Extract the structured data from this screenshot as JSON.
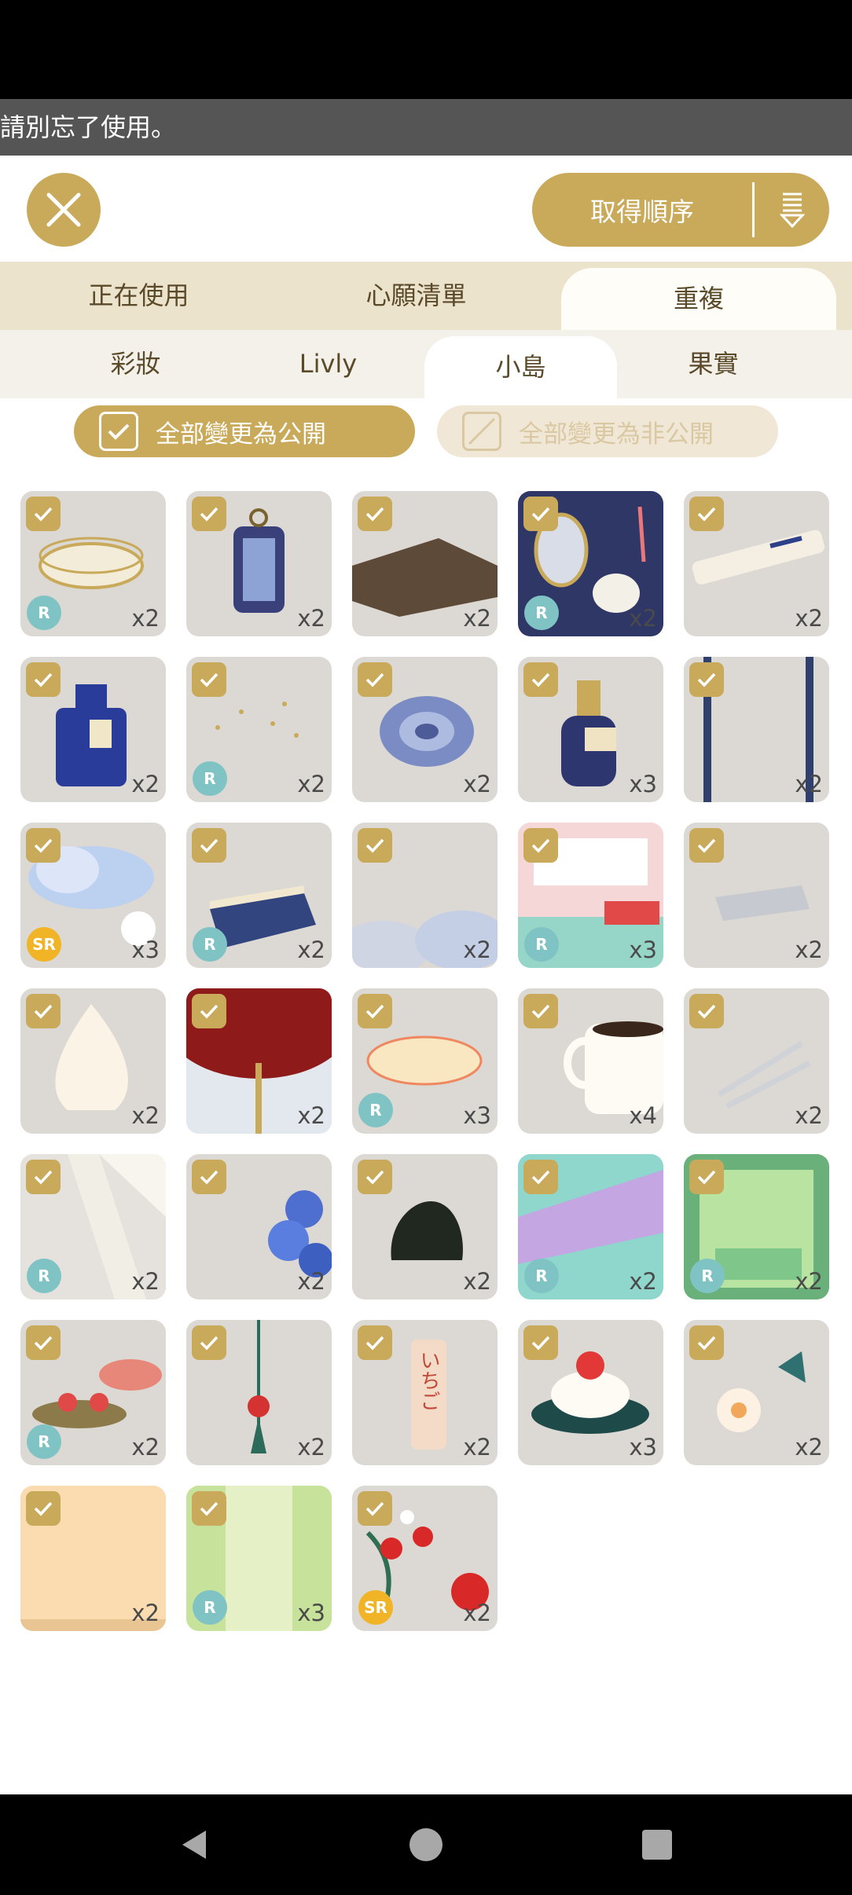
{
  "notice": "請別忘了使用。",
  "sort": {
    "label": "取得順序"
  },
  "tabs": [
    "正在使用",
    "心願清單",
    "重複"
  ],
  "subtabs": [
    "彩妝",
    "Livly",
    "小島",
    "果實"
  ],
  "buttons": {
    "public_all": "全部變更為公開",
    "private_all": "全部變更為非公開"
  },
  "colors": {
    "accent": "#c9a95a",
    "tile_bg": "#dcd8d3",
    "rarity_r": "#7fc3c5",
    "rarity_sr": "#f0b426"
  },
  "items": [
    {
      "icon": "glass-dish-icon",
      "rarity": "R",
      "count": "x2"
    },
    {
      "icon": "lantern-icon",
      "rarity": "",
      "count": "x2"
    },
    {
      "icon": "wooden-floor-icon",
      "rarity": "",
      "count": "x2"
    },
    {
      "icon": "mirror-vanity-icon",
      "rarity": "R",
      "count": "x2"
    },
    {
      "icon": "pen-icon",
      "rarity": "",
      "count": "x2"
    },
    {
      "icon": "perfume-bottle-icon",
      "rarity": "",
      "count": "x2"
    },
    {
      "icon": "sparkles-icon",
      "rarity": "R",
      "count": "x2"
    },
    {
      "icon": "shell-icon",
      "rarity": "",
      "count": "x2"
    },
    {
      "icon": "bottle-icon",
      "rarity": "",
      "count": "x3"
    },
    {
      "icon": "pillars-icon",
      "rarity": "",
      "count": "x2"
    },
    {
      "icon": "cloud-icon",
      "rarity": "SR",
      "count": "x3"
    },
    {
      "icon": "book-icon",
      "rarity": "R",
      "count": "x2"
    },
    {
      "icon": "cloud-floor-icon",
      "rarity": "",
      "count": "x2"
    },
    {
      "icon": "shop-counter-icon",
      "rarity": "R",
      "count": "x3"
    },
    {
      "icon": "newspaper-icon",
      "rarity": "",
      "count": "x2"
    },
    {
      "icon": "soft-serve-icon",
      "rarity": "",
      "count": "x2"
    },
    {
      "icon": "red-table-icon",
      "rarity": "",
      "count": "x2"
    },
    {
      "icon": "flower-plate-icon",
      "rarity": "R",
      "count": "x3"
    },
    {
      "icon": "coffee-cup-icon",
      "rarity": "",
      "count": "x4"
    },
    {
      "icon": "fork-knife-icon",
      "rarity": "",
      "count": "x2"
    },
    {
      "icon": "light-rays-icon",
      "rarity": "R",
      "count": "x2"
    },
    {
      "icon": "hydrangea-icon",
      "rarity": "",
      "count": "x2"
    },
    {
      "icon": "rock-icon",
      "rarity": "",
      "count": "x2"
    },
    {
      "icon": "aurora-wall-icon",
      "rarity": "R",
      "count": "x2"
    },
    {
      "icon": "garden-window-icon",
      "rarity": "R",
      "count": "x2"
    },
    {
      "icon": "cake-stand-icon",
      "rarity": "R",
      "count": "x2"
    },
    {
      "icon": "hanging-charm-icon",
      "rarity": "",
      "count": "x2"
    },
    {
      "icon": "ichigo-sign-icon",
      "rarity": "",
      "count": "x2",
      "text": "いちご"
    },
    {
      "icon": "strawberry-cake-icon",
      "rarity": "",
      "count": "x3"
    },
    {
      "icon": "white-flower-icon",
      "rarity": "",
      "count": "x2"
    },
    {
      "icon": "wood-wall-icon",
      "rarity": "",
      "count": "x2"
    },
    {
      "icon": "green-curtain-icon",
      "rarity": "R",
      "count": "x3"
    },
    {
      "icon": "strawberry-plant-icon",
      "rarity": "SR",
      "count": "x2"
    }
  ]
}
